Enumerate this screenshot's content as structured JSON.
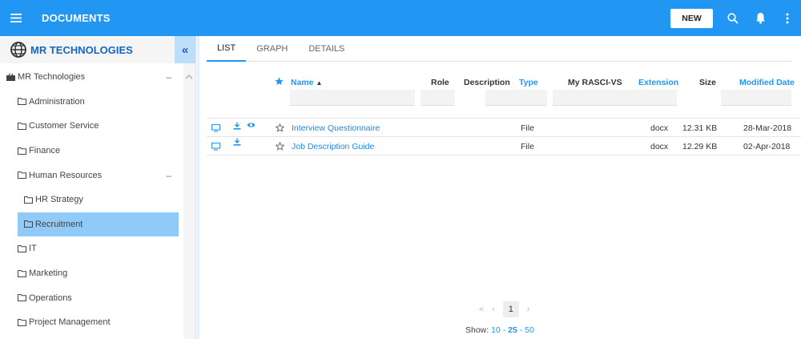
{
  "app": {
    "title": "DOCUMENTS"
  },
  "toolbar": {
    "new_label": "NEW"
  },
  "sidebar": {
    "org_name": "MR TECHNOLOGIES",
    "collapse_glyph": "«",
    "items": [
      {
        "label": "MR Technologies",
        "toggle": "–"
      },
      {
        "label": "Administration"
      },
      {
        "label": "Customer Service"
      },
      {
        "label": "Finance"
      },
      {
        "label": "Human Resources",
        "toggle": "–"
      },
      {
        "label": "HR Strategy"
      },
      {
        "label": "Recruitment"
      },
      {
        "label": "IT"
      },
      {
        "label": "Marketing"
      },
      {
        "label": "Operations"
      },
      {
        "label": "Project Management"
      }
    ]
  },
  "tabs": [
    "LIST",
    "GRAPH",
    "DETAILS"
  ],
  "table": {
    "headers": {
      "name": "Name",
      "role": "Role",
      "description": "Description",
      "type": "Type",
      "rasci": "My RASCI-VS",
      "extension": "Extension",
      "size": "Size",
      "modified": "Modified Date"
    },
    "rows": [
      {
        "name": "Interview Questionnaire",
        "type": "File",
        "extension": "docx",
        "size": "12.31 KB",
        "modified": "28-Mar-2018"
      },
      {
        "name": "Job Description Guide",
        "type": "File",
        "extension": "docx",
        "size": "12.29 KB",
        "modified": "02-Apr-2018"
      }
    ]
  },
  "pager": {
    "first": "«",
    "prev": "‹",
    "current": "1",
    "next": "›",
    "show_label": "Show:",
    "options": [
      "10",
      "25",
      "50"
    ],
    "sep": "-"
  },
  "colors": {
    "primary": "#2196f3",
    "selected": "#90caf9",
    "link": "#1e88e5"
  }
}
